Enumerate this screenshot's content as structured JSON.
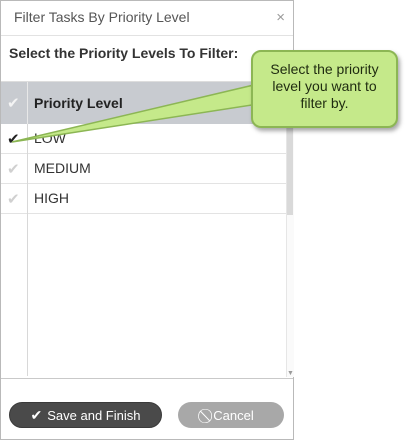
{
  "dialog": {
    "title": "Filter Tasks By Priority Level",
    "close_glyph": "×",
    "instruction": "Select the Priority Levels To Filter:"
  },
  "grid": {
    "column_header": "Priority Level",
    "rows": [
      {
        "label": "LOW",
        "selected": true
      },
      {
        "label": "MEDIUM",
        "selected": false
      },
      {
        "label": "HIGH",
        "selected": false
      }
    ]
  },
  "buttons": {
    "save_label": "Save and Finish",
    "cancel_label": "Cancel"
  },
  "callout": {
    "text": "Select the priority level you want to filter by."
  },
  "colors": {
    "header_bg": "#c8cbd0",
    "save_bg": "#4a4a4a",
    "cancel_bg": "#a8a8a8",
    "callout_bg": "#c5e98a",
    "callout_border": "#8cb654"
  },
  "icons": {
    "check": "check-icon",
    "close": "close-icon",
    "cancel": "ban-icon"
  }
}
